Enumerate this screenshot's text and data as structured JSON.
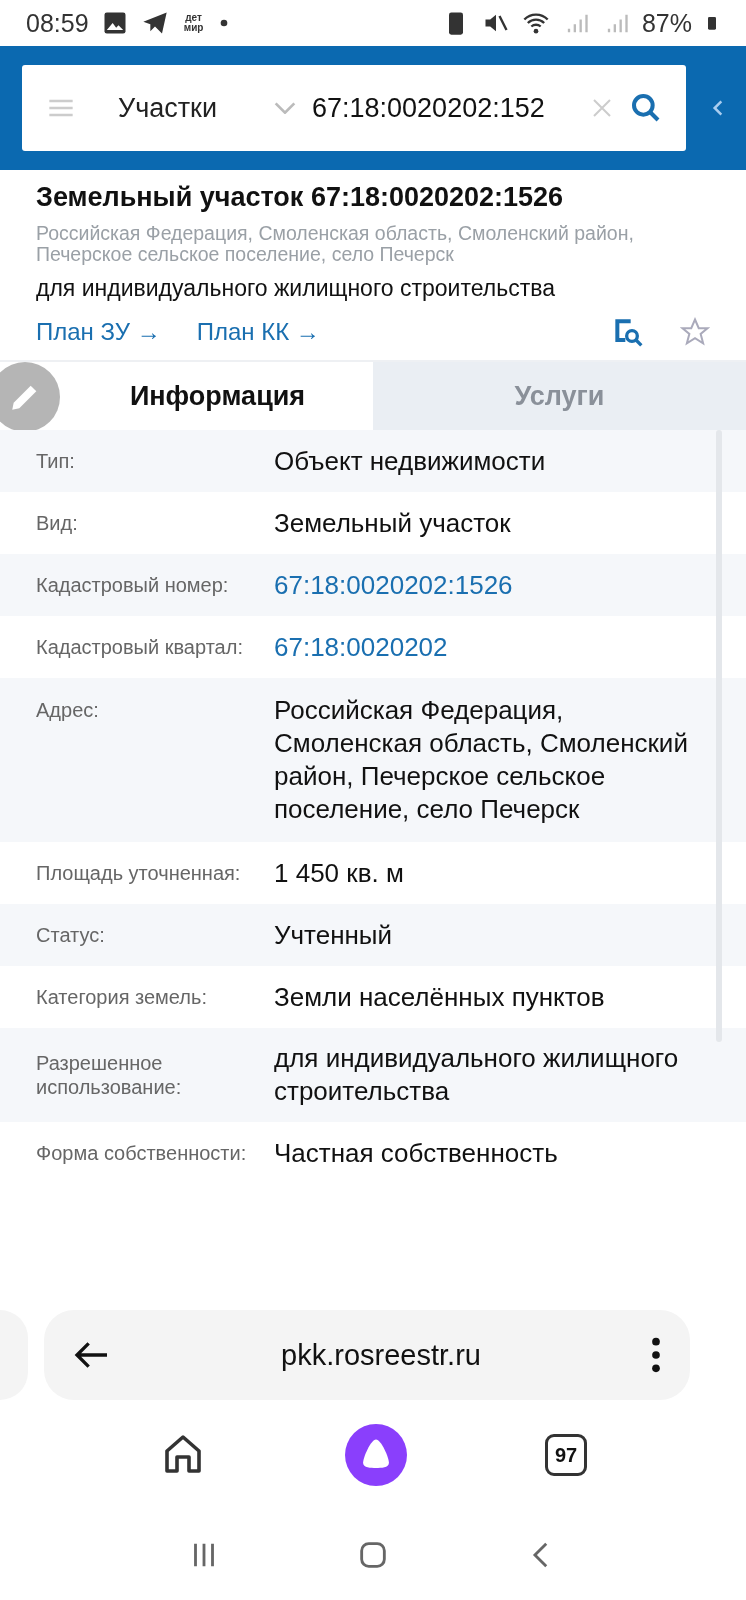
{
  "status_bar": {
    "time": "08:59",
    "app_logo": "дет мир",
    "battery": "87%"
  },
  "search_bar": {
    "category": "Участки",
    "query": "67:18:0020202:152"
  },
  "object": {
    "title": "Земельный участок 67:18:0020202:1526",
    "address": "Российская Федерация, Смоленская область, Смоленский район, Печерское сельское поселение, село Печерск",
    "purpose": "для индивидуального жилищного строительства",
    "links": [
      "План ЗУ →",
      "План КК →"
    ],
    "favorite": false
  },
  "tabs": [
    {
      "label": "Информация",
      "selected": true
    },
    {
      "label": "Услуги",
      "selected": false
    }
  ],
  "rows": [
    {
      "label": "Тип:",
      "value": "Объект недвижимости",
      "kind": "text"
    },
    {
      "label": "Вид:",
      "value": "Земельный участок",
      "kind": "text"
    },
    {
      "label": "Кадастровый номер:",
      "value": "67:18:0020202:1526",
      "kind": "link"
    },
    {
      "label": "Кадастровый квартал:",
      "value": "67:18:0020202",
      "kind": "link"
    },
    {
      "label": "Адрес:",
      "value": "Российская Федерация, Смоленская область, Смоленский район, Печерское сельское поселение, село Печерск",
      "kind": "text"
    },
    {
      "label": "Площадь уточненная:",
      "value": "1 450 кв. м",
      "kind": "text"
    },
    {
      "label": "Статус:",
      "value": "Учтенный",
      "kind": "text"
    },
    {
      "label": "Категория земель:",
      "value": "Земли населённых пунктов",
      "kind": "text"
    },
    {
      "label": "Разрешенное использование:",
      "value": "для индивидуального жилищного строительства",
      "kind": "text"
    },
    {
      "label": "Форма собственности:",
      "value": "Частная собственность",
      "kind": "text"
    }
  ],
  "browser": {
    "url": "pkk.rosreestr.ru",
    "tab_count": "97"
  }
}
